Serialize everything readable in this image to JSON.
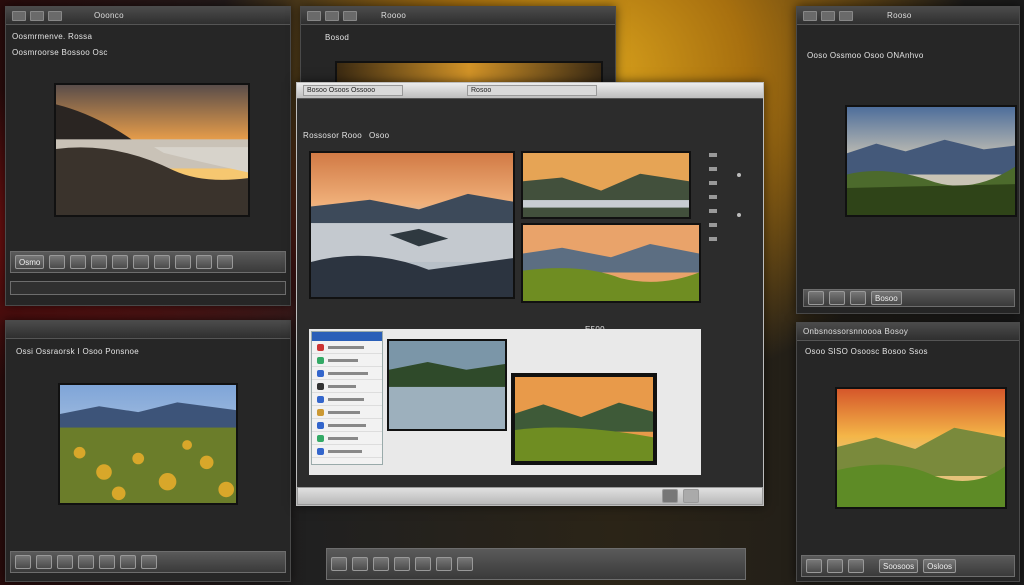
{
  "colors": {
    "accent": "#2a5fb8",
    "gold": "#d9a21c",
    "panel": "#262626"
  },
  "top_left": {
    "tab": "Ooonco",
    "heading": "Oosmrmenve. Rossa",
    "sub": "Oosmroorse Bossoo Osc"
  },
  "top_left_strip": {
    "label": "Osmo"
  },
  "top_center": {
    "tab": "Roooo",
    "sub": "Bosod"
  },
  "main": {
    "title": "Bosoo Osoos Ossooo",
    "field1": "Rosoo",
    "row_label": "Rossosor Rooo",
    "row_label2": "Osoo",
    "center_caption": "E500"
  },
  "top_right": {
    "tab": "Rooso",
    "heading": "Ooso Ossmoo Osoo ONAnhvo",
    "strip_label": "Bosoo"
  },
  "bottom_left": {
    "heading": "Ossi Ossraorsk I Osoo Ponsnoe"
  },
  "bottom_right": {
    "heading": "Onbsnossorsnnoooa Bosoy",
    "sub": "Osoo  SISO Osoosc Bosoo Ssos",
    "bottom_btn1": "Soosoos",
    "bottom_btn2": "Osloos"
  }
}
